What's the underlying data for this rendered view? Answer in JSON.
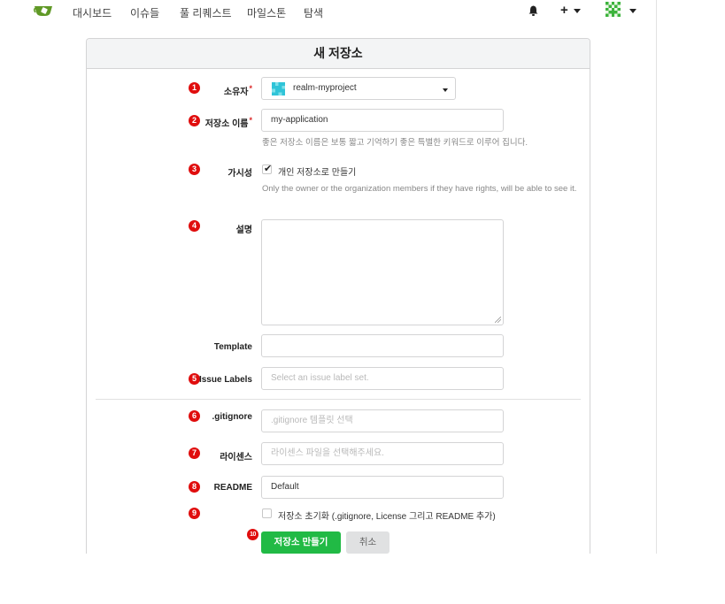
{
  "nav": {
    "items": [
      "대시보드",
      "이슈들",
      "풀 리퀘스트",
      "마일스톤",
      "탐색"
    ]
  },
  "form": {
    "title": "새 저장소",
    "owner": {
      "label": "소유자",
      "value": "realm-myproject"
    },
    "repo_name": {
      "label": "저장소 이름",
      "value": "my-application",
      "help": "좋은 저장소 이름은 보통 짧고 기억하기 좋은 특별한 키워드로 이루어 집니다."
    },
    "visibility": {
      "label": "가시성",
      "checkbox_label": "개인 저장소로 만들기",
      "checked": true,
      "help": "Only the owner or the organization members if they have rights, will be able to see it."
    },
    "description": {
      "label": "설명",
      "value": ""
    },
    "template": {
      "label": "Template",
      "value": ""
    },
    "issue_labels": {
      "label": "Issue Labels",
      "placeholder": "Select an issue label set."
    },
    "gitignore": {
      "label": ".gitignore",
      "placeholder": ".gitignore 템플릿 선택"
    },
    "license": {
      "label": "라이센스",
      "placeholder": "라이센스 파일을 선택해주세요."
    },
    "readme": {
      "label": "README",
      "value": "Default"
    },
    "auto_init": {
      "label": "저장소 초기화 (.gitignore, License 그리고 README 추가)",
      "checked": false
    },
    "submit_label": "저장소 만들기",
    "cancel_label": "취소"
  },
  "annotations": [
    "1",
    "2",
    "3",
    "4",
    "5",
    "6",
    "7",
    "8",
    "9",
    "10"
  ],
  "colors": {
    "primary": "#21ba45",
    "badge": "#e00d0d",
    "required": "#db2828"
  }
}
